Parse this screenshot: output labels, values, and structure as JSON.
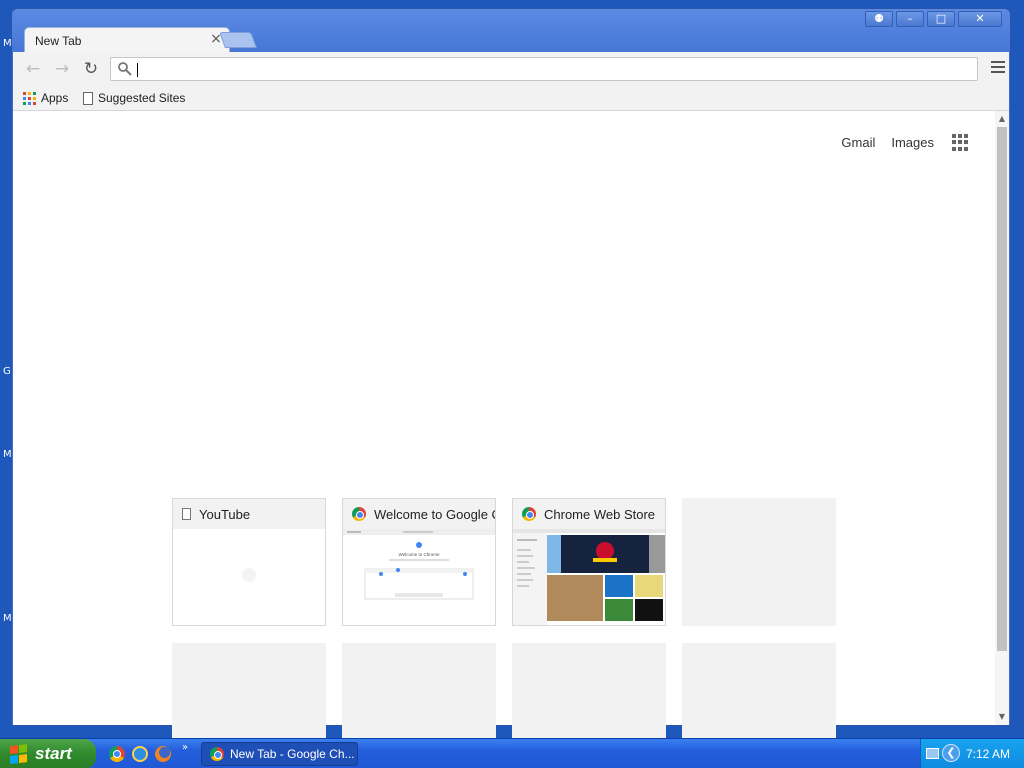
{
  "desktop": {
    "edge_letters": [
      "M",
      "G",
      "M",
      "M"
    ]
  },
  "window": {
    "controls": {
      "user": "⚉",
      "minimize": "–",
      "maximize": "□",
      "close": "✕"
    }
  },
  "tab": {
    "title": "New Tab",
    "close_glyph": "×"
  },
  "toolbar": {
    "back_glyph": "←",
    "forward_glyph": "→",
    "reload_glyph": "↻",
    "omnibox_value": ""
  },
  "bookmarks": {
    "apps_label": "Apps",
    "suggested_label": "Suggested Sites"
  },
  "top_links": {
    "gmail": "Gmail",
    "images": "Images"
  },
  "tiles": [
    {
      "title": "YouTube",
      "favicon": "page-icon"
    },
    {
      "title": "Welcome to Google C",
      "favicon": "chrome-icon"
    },
    {
      "title": "Chrome Web Store",
      "favicon": "chrome-store-icon"
    },
    {
      "title": "",
      "favicon": ""
    },
    {
      "title": "",
      "favicon": ""
    },
    {
      "title": "",
      "favicon": ""
    },
    {
      "title": "",
      "favicon": ""
    },
    {
      "title": "",
      "favicon": ""
    }
  ],
  "welcome_thumb": {
    "heading": "Welcome to Chrome"
  },
  "taskbar": {
    "start_label": "start",
    "more_glyph": "»",
    "task_label": "New Tab - Google Ch...",
    "clock": "7:12 AM",
    "tray_arrow": "❮"
  },
  "colors": {
    "desktop": "#1d58ba",
    "title_bar": "#4677d6",
    "start_green": "#2f8a2c",
    "tray_blue": "#0f8ae0"
  }
}
